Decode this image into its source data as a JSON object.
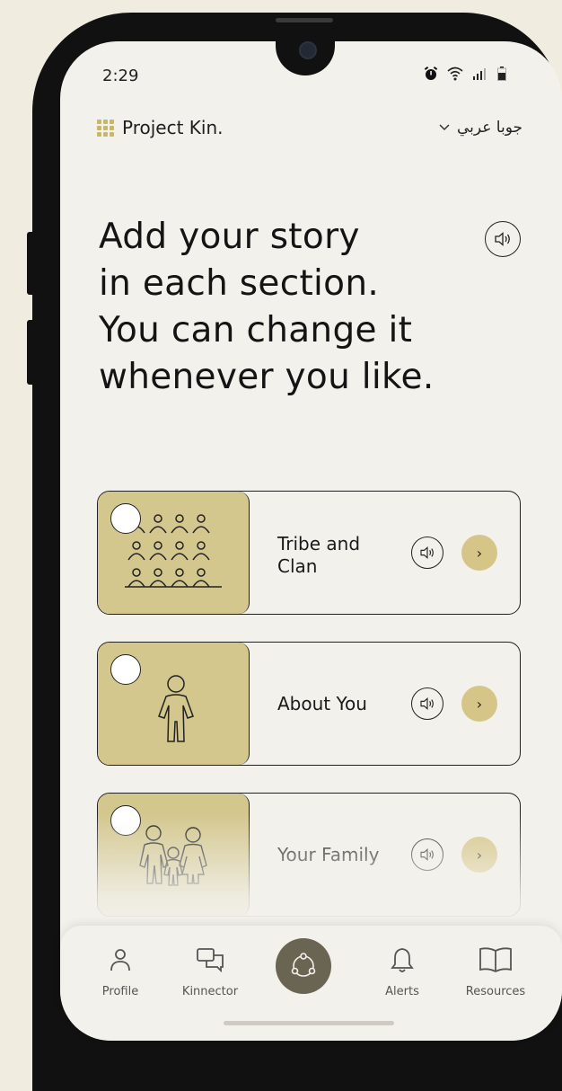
{
  "status_bar": {
    "time": "2:29"
  },
  "header": {
    "app_name": "Project Kin.",
    "language": "جوبا عربي"
  },
  "main": {
    "headline": [
      "Add your story",
      "in each section.",
      "You can change it",
      "whenever you like."
    ]
  },
  "sections": [
    {
      "label_line1": "Tribe and",
      "label_line2": "Clan",
      "next": "›"
    },
    {
      "label_line1": "About You",
      "label_line2": "",
      "next": "›"
    },
    {
      "label_line1": "Your Family",
      "label_line2": "",
      "next": "›"
    }
  ],
  "tabbar": {
    "profile": "Profile",
    "kinnector": "Kinnector",
    "alerts": "Alerts",
    "resources": "Resources"
  },
  "colors": {
    "accent": "#d5c687",
    "card_image_bg": "#d3c78e",
    "center_button": "#6a6452",
    "screen_bg": "#f3f1ec"
  },
  "icons": {
    "logo": "grid-dots-icon",
    "language_toggle": "chevron-down-icon",
    "audio": "speaker-icon",
    "next": "chevron-right-icon",
    "profile": "person-icon",
    "kinnector": "chat-bubbles-icon",
    "center": "network-icon",
    "alerts": "bell-icon",
    "resources": "book-icon"
  }
}
